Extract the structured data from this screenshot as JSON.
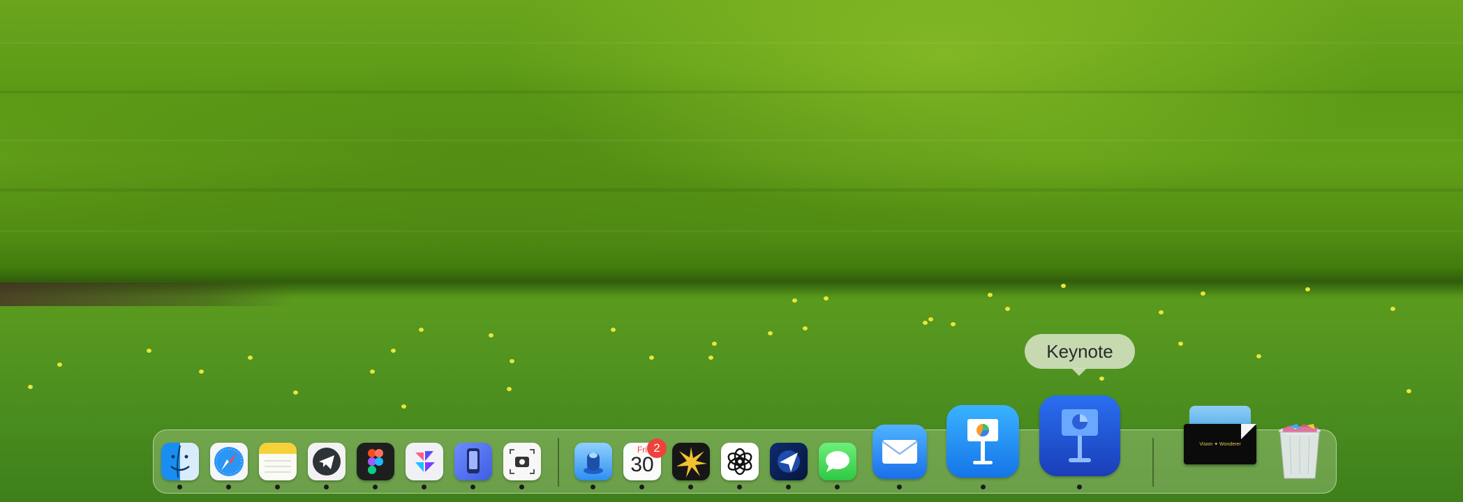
{
  "tooltip": {
    "text": "Keynote"
  },
  "dock": {
    "apps": [
      {
        "name": "Finder",
        "icon": "finder-icon",
        "running": true
      },
      {
        "name": "Safari",
        "icon": "safari-icon",
        "running": true
      },
      {
        "name": "Notes",
        "icon": "notes-icon",
        "running": true
      },
      {
        "name": "Telegram",
        "icon": "telegram-icon",
        "running": true
      },
      {
        "name": "Figma",
        "icon": "figma-icon",
        "running": true
      },
      {
        "name": "Craft",
        "icon": "craft-icon",
        "running": true
      },
      {
        "name": "Simulator",
        "icon": "simulator-icon",
        "running": true
      },
      {
        "name": "Screenshot",
        "icon": "screenshot-icon",
        "running": true
      },
      {
        "name": "Cleaner",
        "icon": "cleaner-icon",
        "running": true
      },
      {
        "name": "Calendar",
        "icon": "calendar-icon",
        "running": true,
        "day_label": "Fri",
        "date": "30",
        "badge": "2"
      },
      {
        "name": "Spark",
        "icon": "spark-icon",
        "running": true
      },
      {
        "name": "ChatGPT",
        "icon": "chatgpt-icon",
        "running": true
      },
      {
        "name": "Navigation",
        "icon": "navigation-icon",
        "running": true
      },
      {
        "name": "Messages",
        "icon": "messages-icon",
        "running": true
      },
      {
        "name": "Mail",
        "icon": "mail-icon",
        "running": true
      },
      {
        "name": "Keynote Classic",
        "icon": "keynote-classic-icon",
        "running": true
      },
      {
        "name": "Keynote",
        "icon": "keynote-icon",
        "running": true,
        "hovered": true
      }
    ],
    "stack_label": "Vision ✦ Wonderer",
    "trash": "trash-icon"
  },
  "colors": {
    "badge": "#f0413a",
    "keynote_blue": "#1e5bd6",
    "messages_green": "#3ddc52"
  }
}
